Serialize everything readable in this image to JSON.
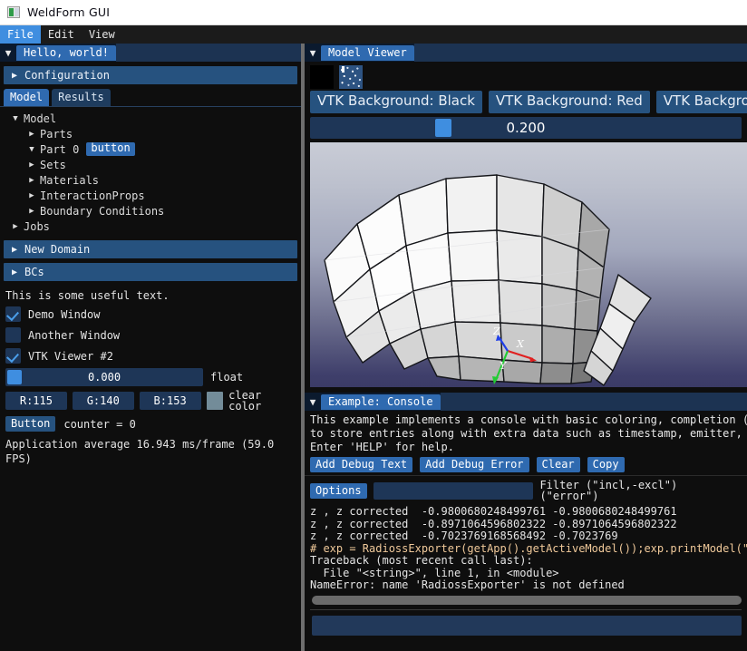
{
  "window": {
    "title": "WeldForm GUI",
    "icon": "app-icon"
  },
  "menubar": {
    "items": [
      {
        "label": "File",
        "active": true
      },
      {
        "label": "Edit",
        "active": false
      },
      {
        "label": "View",
        "active": false
      }
    ]
  },
  "left_panel": {
    "header": {
      "title": "Hello, world!",
      "collapse_icon": "▼"
    },
    "collapsing_header": {
      "label": "Configuration",
      "arrow": "▶"
    },
    "tabs": [
      {
        "label": "Model",
        "selected": true
      },
      {
        "label": "Results",
        "selected": false
      }
    ],
    "tree": [
      {
        "label": "Model",
        "arrow": "▼",
        "indent": 0,
        "badge": null
      },
      {
        "label": "Parts",
        "arrow": "▶",
        "indent": 1,
        "badge": null
      },
      {
        "label": "Part 0",
        "arrow": "▼",
        "indent": 1,
        "badge": "button"
      },
      {
        "label": "Sets",
        "arrow": "▶",
        "indent": 1,
        "badge": null
      },
      {
        "label": "Materials",
        "arrow": "▶",
        "indent": 1,
        "badge": null
      },
      {
        "label": "InteractionProps",
        "arrow": "▶",
        "indent": 1,
        "badge": null
      },
      {
        "label": "Boundary Conditions",
        "arrow": "▶",
        "indent": 1,
        "badge": null
      },
      {
        "label": "Jobs",
        "arrow": "▶",
        "indent": 0,
        "badge": null
      }
    ],
    "headers": [
      {
        "label": "New Domain",
        "arrow": "▶"
      },
      {
        "label": "BCs",
        "arrow": "▶"
      }
    ],
    "static_text": "This is some useful text.",
    "checkboxes": [
      {
        "label": "Demo Window",
        "checked": true
      },
      {
        "label": "Another Window",
        "checked": false
      },
      {
        "label": "VTK Viewer #2",
        "checked": true
      }
    ],
    "float_slider": {
      "value": "0.000",
      "label": "float",
      "fill_percent": 4
    },
    "color_drags": [
      {
        "label": "R:115"
      },
      {
        "label": "G:140"
      },
      {
        "label": "B:153"
      }
    ],
    "color_swatch_label": "clear color",
    "color_swatch_hex": "#738c99",
    "button": {
      "label": "Button",
      "counter_text": "counter = 0"
    },
    "perf_text": "Application average 16.943 ms/frame (59.0 FPS)"
  },
  "right_panel": {
    "viewer": {
      "header": {
        "title": "Model Viewer",
        "collapse_icon": "▼"
      },
      "thumbnails": [
        "black-thumbnail",
        "noise-thumbnail"
      ],
      "background_buttons": [
        "VTK Background: Black",
        "VTK Background: Red",
        "VTK Background:"
      ],
      "slider": {
        "value": "0.200",
        "fill_percent": 29
      },
      "axes": {
        "x": "X",
        "y": "Y",
        "z": "Z",
        "x_color": "#e02020",
        "y_color": "#22cc33",
        "z_color": "#2040e8"
      }
    },
    "console": {
      "header": {
        "title": "Example: Console",
        "collapse_icon": "▼"
      },
      "description": [
        "This example implements a console with basic coloring, completion (TA",
        "to store entries along with extra data such as timestamp, emitter, et",
        "Enter 'HELP' for help."
      ],
      "buttons": [
        "Add Debug Text",
        "Add Debug Error",
        "Clear",
        "Copy"
      ],
      "options_button": "Options",
      "filter_value": "",
      "filter_label": "Filter (\"incl,-excl\") (\"error\")",
      "log": [
        {
          "text": "z , z corrected  -0.9800680248499761 -0.9800680248499761",
          "type": "normal"
        },
        {
          "text": "z , z corrected  -0.8971064596802322 -0.8971064596802322",
          "type": "normal"
        },
        {
          "text": "z , z corrected  -0.7023769168568492 -0.7023769",
          "type": "normal"
        },
        {
          "text": "# exp = RadiossExporter(getApp().getActiveModel());exp.printModel(\"te",
          "type": "command"
        },
        {
          "text": "Traceback (most recent call last):",
          "type": "normal"
        },
        {
          "text": "  File \"<string>\", line 1, in <module>",
          "type": "normal"
        },
        {
          "text": "NameError: name 'RadiossExporter' is not defined",
          "type": "normal"
        }
      ],
      "input_value": ""
    }
  }
}
